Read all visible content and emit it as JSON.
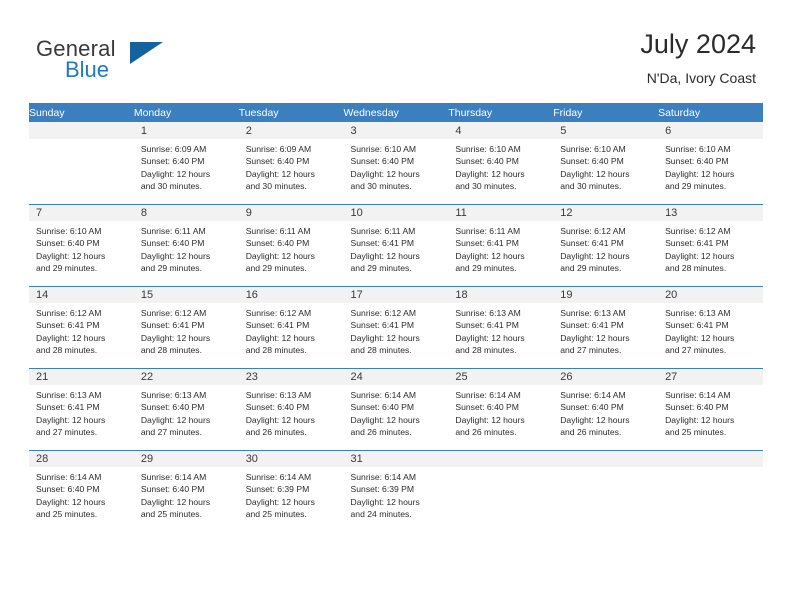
{
  "brand": {
    "name_top": "General",
    "name_bottom": "Blue",
    "flag_icon": "triangle-flag-icon",
    "accent_color": "#15629f",
    "blue_text_color": "#1f7ac0"
  },
  "header": {
    "title": "July 2024",
    "subtitle": "N'Da, Ivory Coast"
  },
  "theme": {
    "header_row_bg": "#3b7fbe",
    "daynum_bg": "#f2f2f2",
    "separator_color": "#3b7fbe",
    "text_color": "#2c2c2c"
  },
  "weekday_headers": [
    "Sunday",
    "Monday",
    "Tuesday",
    "Wednesday",
    "Thursday",
    "Friday",
    "Saturday"
  ],
  "labels": {
    "sunrise_prefix": "Sunrise:",
    "sunset_prefix": "Sunset:",
    "daylight_prefix": "Daylight:"
  },
  "weeks": [
    [
      {
        "day": "",
        "sunrise": "",
        "sunset": "",
        "daylight_line1": "",
        "daylight_line2": ""
      },
      {
        "day": "1",
        "sunrise": "Sunrise: 6:09 AM",
        "sunset": "Sunset: 6:40 PM",
        "daylight_line1": "Daylight: 12 hours",
        "daylight_line2": "and 30 minutes."
      },
      {
        "day": "2",
        "sunrise": "Sunrise: 6:09 AM",
        "sunset": "Sunset: 6:40 PM",
        "daylight_line1": "Daylight: 12 hours",
        "daylight_line2": "and 30 minutes."
      },
      {
        "day": "3",
        "sunrise": "Sunrise: 6:10 AM",
        "sunset": "Sunset: 6:40 PM",
        "daylight_line1": "Daylight: 12 hours",
        "daylight_line2": "and 30 minutes."
      },
      {
        "day": "4",
        "sunrise": "Sunrise: 6:10 AM",
        "sunset": "Sunset: 6:40 PM",
        "daylight_line1": "Daylight: 12 hours",
        "daylight_line2": "and 30 minutes."
      },
      {
        "day": "5",
        "sunrise": "Sunrise: 6:10 AM",
        "sunset": "Sunset: 6:40 PM",
        "daylight_line1": "Daylight: 12 hours",
        "daylight_line2": "and 30 minutes."
      },
      {
        "day": "6",
        "sunrise": "Sunrise: 6:10 AM",
        "sunset": "Sunset: 6:40 PM",
        "daylight_line1": "Daylight: 12 hours",
        "daylight_line2": "and 29 minutes."
      }
    ],
    [
      {
        "day": "7",
        "sunrise": "Sunrise: 6:10 AM",
        "sunset": "Sunset: 6:40 PM",
        "daylight_line1": "Daylight: 12 hours",
        "daylight_line2": "and 29 minutes."
      },
      {
        "day": "8",
        "sunrise": "Sunrise: 6:11 AM",
        "sunset": "Sunset: 6:40 PM",
        "daylight_line1": "Daylight: 12 hours",
        "daylight_line2": "and 29 minutes."
      },
      {
        "day": "9",
        "sunrise": "Sunrise: 6:11 AM",
        "sunset": "Sunset: 6:40 PM",
        "daylight_line1": "Daylight: 12 hours",
        "daylight_line2": "and 29 minutes."
      },
      {
        "day": "10",
        "sunrise": "Sunrise: 6:11 AM",
        "sunset": "Sunset: 6:41 PM",
        "daylight_line1": "Daylight: 12 hours",
        "daylight_line2": "and 29 minutes."
      },
      {
        "day": "11",
        "sunrise": "Sunrise: 6:11 AM",
        "sunset": "Sunset: 6:41 PM",
        "daylight_line1": "Daylight: 12 hours",
        "daylight_line2": "and 29 minutes."
      },
      {
        "day": "12",
        "sunrise": "Sunrise: 6:12 AM",
        "sunset": "Sunset: 6:41 PM",
        "daylight_line1": "Daylight: 12 hours",
        "daylight_line2": "and 29 minutes."
      },
      {
        "day": "13",
        "sunrise": "Sunrise: 6:12 AM",
        "sunset": "Sunset: 6:41 PM",
        "daylight_line1": "Daylight: 12 hours",
        "daylight_line2": "and 28 minutes."
      }
    ],
    [
      {
        "day": "14",
        "sunrise": "Sunrise: 6:12 AM",
        "sunset": "Sunset: 6:41 PM",
        "daylight_line1": "Daylight: 12 hours",
        "daylight_line2": "and 28 minutes."
      },
      {
        "day": "15",
        "sunrise": "Sunrise: 6:12 AM",
        "sunset": "Sunset: 6:41 PM",
        "daylight_line1": "Daylight: 12 hours",
        "daylight_line2": "and 28 minutes."
      },
      {
        "day": "16",
        "sunrise": "Sunrise: 6:12 AM",
        "sunset": "Sunset: 6:41 PM",
        "daylight_line1": "Daylight: 12 hours",
        "daylight_line2": "and 28 minutes."
      },
      {
        "day": "17",
        "sunrise": "Sunrise: 6:12 AM",
        "sunset": "Sunset: 6:41 PM",
        "daylight_line1": "Daylight: 12 hours",
        "daylight_line2": "and 28 minutes."
      },
      {
        "day": "18",
        "sunrise": "Sunrise: 6:13 AM",
        "sunset": "Sunset: 6:41 PM",
        "daylight_line1": "Daylight: 12 hours",
        "daylight_line2": "and 28 minutes."
      },
      {
        "day": "19",
        "sunrise": "Sunrise: 6:13 AM",
        "sunset": "Sunset: 6:41 PM",
        "daylight_line1": "Daylight: 12 hours",
        "daylight_line2": "and 27 minutes."
      },
      {
        "day": "20",
        "sunrise": "Sunrise: 6:13 AM",
        "sunset": "Sunset: 6:41 PM",
        "daylight_line1": "Daylight: 12 hours",
        "daylight_line2": "and 27 minutes."
      }
    ],
    [
      {
        "day": "21",
        "sunrise": "Sunrise: 6:13 AM",
        "sunset": "Sunset: 6:41 PM",
        "daylight_line1": "Daylight: 12 hours",
        "daylight_line2": "and 27 minutes."
      },
      {
        "day": "22",
        "sunrise": "Sunrise: 6:13 AM",
        "sunset": "Sunset: 6:40 PM",
        "daylight_line1": "Daylight: 12 hours",
        "daylight_line2": "and 27 minutes."
      },
      {
        "day": "23",
        "sunrise": "Sunrise: 6:13 AM",
        "sunset": "Sunset: 6:40 PM",
        "daylight_line1": "Daylight: 12 hours",
        "daylight_line2": "and 26 minutes."
      },
      {
        "day": "24",
        "sunrise": "Sunrise: 6:14 AM",
        "sunset": "Sunset: 6:40 PM",
        "daylight_line1": "Daylight: 12 hours",
        "daylight_line2": "and 26 minutes."
      },
      {
        "day": "25",
        "sunrise": "Sunrise: 6:14 AM",
        "sunset": "Sunset: 6:40 PM",
        "daylight_line1": "Daylight: 12 hours",
        "daylight_line2": "and 26 minutes."
      },
      {
        "day": "26",
        "sunrise": "Sunrise: 6:14 AM",
        "sunset": "Sunset: 6:40 PM",
        "daylight_line1": "Daylight: 12 hours",
        "daylight_line2": "and 26 minutes."
      },
      {
        "day": "27",
        "sunrise": "Sunrise: 6:14 AM",
        "sunset": "Sunset: 6:40 PM",
        "daylight_line1": "Daylight: 12 hours",
        "daylight_line2": "and 25 minutes."
      }
    ],
    [
      {
        "day": "28",
        "sunrise": "Sunrise: 6:14 AM",
        "sunset": "Sunset: 6:40 PM",
        "daylight_line1": "Daylight: 12 hours",
        "daylight_line2": "and 25 minutes."
      },
      {
        "day": "29",
        "sunrise": "Sunrise: 6:14 AM",
        "sunset": "Sunset: 6:40 PM",
        "daylight_line1": "Daylight: 12 hours",
        "daylight_line2": "and 25 minutes."
      },
      {
        "day": "30",
        "sunrise": "Sunrise: 6:14 AM",
        "sunset": "Sunset: 6:39 PM",
        "daylight_line1": "Daylight: 12 hours",
        "daylight_line2": "and 25 minutes."
      },
      {
        "day": "31",
        "sunrise": "Sunrise: 6:14 AM",
        "sunset": "Sunset: 6:39 PM",
        "daylight_line1": "Daylight: 12 hours",
        "daylight_line2": "and 24 minutes."
      },
      {
        "day": "",
        "sunrise": "",
        "sunset": "",
        "daylight_line1": "",
        "daylight_line2": ""
      },
      {
        "day": "",
        "sunrise": "",
        "sunset": "",
        "daylight_line1": "",
        "daylight_line2": ""
      },
      {
        "day": "",
        "sunrise": "",
        "sunset": "",
        "daylight_line1": "",
        "daylight_line2": ""
      }
    ]
  ]
}
